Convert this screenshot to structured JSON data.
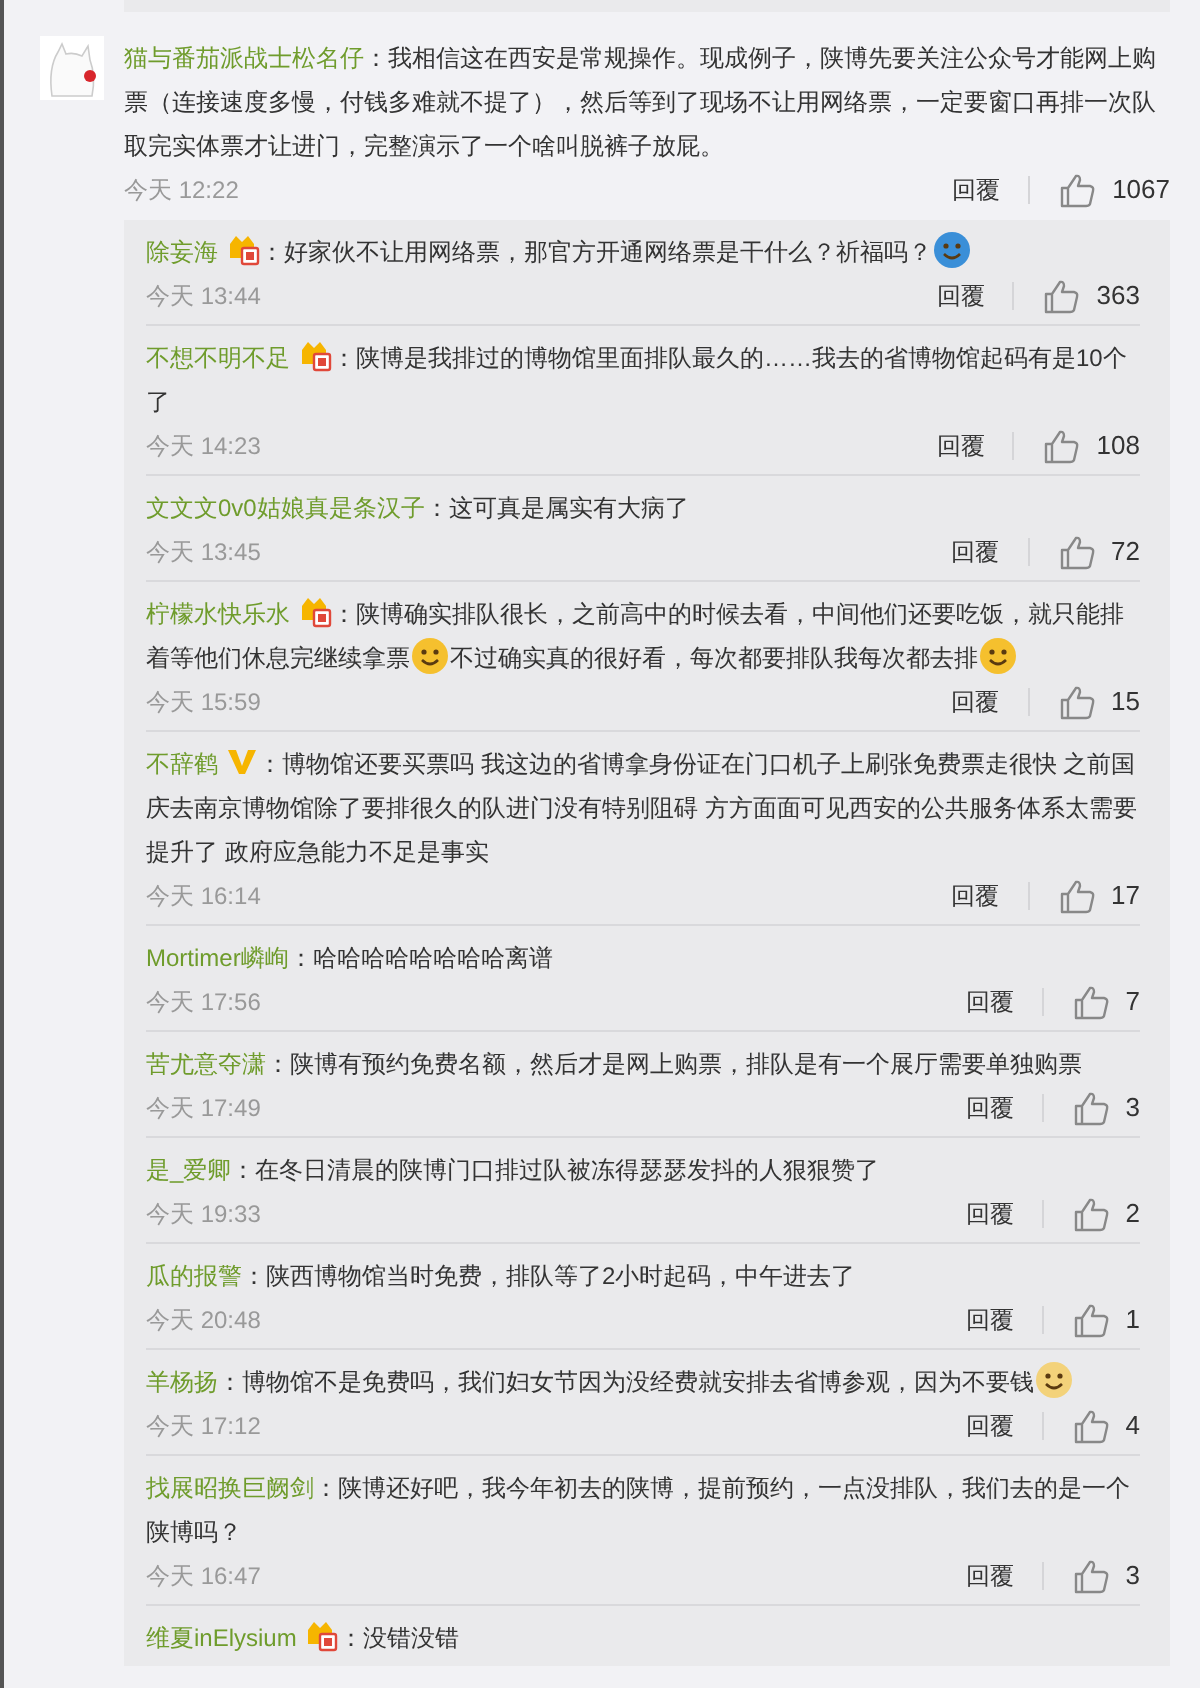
{
  "comment": {
    "author": "猫与番茄派战士松名仔",
    "content": [
      {
        "kind": "text",
        "text": "：我相信这在西安是常规操作。现成例子，陕博先要关注公众号才能网上购票（连接速度多慢，付钱多难就不提了），然后等到了现场不让用网络票，一定要窗口再排一次队取完实体票才让进门，完整演示了一个啥叫脱裤子放屁。"
      }
    ],
    "time": "今天 12:22",
    "reply_label": "回覆",
    "likes": "1067"
  },
  "replies": [
    {
      "author": "除妄海",
      "vip": true,
      "content": [
        {
          "kind": "text",
          "text": "：好家伙不让用网络票，那官方开通网络票是干什么？祈福吗？"
        },
        {
          "kind": "emoji",
          "color": "#3a8fd8"
        }
      ],
      "time": "今天 13:44",
      "reply_label": "回覆",
      "likes": "363"
    },
    {
      "author": "不想不明不足",
      "vip": true,
      "content": [
        {
          "kind": "text",
          "text": "：陕博是我排过的博物馆里面排队最久的……我去的省博物馆起码有是10个了"
        }
      ],
      "time": "今天 14:23",
      "reply_label": "回覆",
      "likes": "108"
    },
    {
      "author": "文文文0v0姑娘真是条汉子",
      "content": [
        {
          "kind": "text",
          "text": "：这可真是属实有大病了"
        }
      ],
      "time": "今天 13:45",
      "reply_label": "回覆",
      "likes": "72"
    },
    {
      "author": "柠檬水快乐水",
      "vip": true,
      "content": [
        {
          "kind": "text",
          "text": "：陕博确实排队很长，之前高中的时候去看，中间他们还要吃饭，就只能排着等他们休息完继续拿票"
        },
        {
          "kind": "emoji",
          "color": "#f5c02e"
        },
        {
          "kind": "text",
          "text": "不过确实真的很好看，每次都要排队我每次都去排"
        },
        {
          "kind": "emoji",
          "color": "#f5c02e"
        }
      ],
      "time": "今天 15:59",
      "reply_label": "回覆",
      "likes": "15"
    },
    {
      "author": "不辞鹤",
      "verified": true,
      "content": [
        {
          "kind": "text",
          "text": "：博物馆还要买票吗 我这边的省博拿身份证在门口机子上刷张免费票走很快 之前国庆去南京博物馆除了要排很久的队进门没有特别阻碍 方方面面可见西安的公共服务体系太需要提升了 政府应急能力不足是事实"
        }
      ],
      "time": "今天 16:14",
      "reply_label": "回覆",
      "likes": "17"
    },
    {
      "author": "Mortimer嶙峋",
      "content": [
        {
          "kind": "text",
          "text": "：哈哈哈哈哈哈哈哈离谱"
        }
      ],
      "time": "今天 17:56",
      "reply_label": "回覆",
      "likes": "7"
    },
    {
      "author": "苦尤意夺潇",
      "content": [
        {
          "kind": "text",
          "text": "：陕博有预约免费名额，然后才是网上购票，排队是有一个展厅需要单独购票"
        }
      ],
      "time": "今天 17:49",
      "reply_label": "回覆",
      "likes": "3"
    },
    {
      "author": "是_爱卿",
      "content": [
        {
          "kind": "text",
          "text": "：在冬日清晨的陕博门口排过队被冻得瑟瑟发抖的人狠狠赞了"
        }
      ],
      "time": "今天 19:33",
      "reply_label": "回覆",
      "likes": "2"
    },
    {
      "author": "瓜的报警",
      "content": [
        {
          "kind": "text",
          "text": "：陕西博物馆当时免费，排队等了2小时起码，中午进去了"
        }
      ],
      "time": "今天 20:48",
      "reply_label": "回覆",
      "likes": "1"
    },
    {
      "author": "羊杨扬",
      "content": [
        {
          "kind": "text",
          "text": "：博物馆不是免费吗，我们妇女节因为没经费就安排去省博参观，因为不要钱"
        },
        {
          "kind": "emoji",
          "color": "#f3d27a"
        }
      ],
      "time": "今天 17:12",
      "reply_label": "回覆",
      "likes": "4"
    },
    {
      "author": "找展昭换巨阙剑",
      "content": [
        {
          "kind": "text",
          "text": "：陕博还好吧，我今年初去的陕博，提前预约，一点没排队，我们去的是一个陕博吗？"
        }
      ],
      "time": "今天 16:47",
      "reply_label": "回覆",
      "likes": "3"
    },
    {
      "author": "维夏inElysium",
      "vip": true,
      "content": [
        {
          "kind": "text",
          "text": "：没错没错"
        }
      ]
    }
  ]
}
